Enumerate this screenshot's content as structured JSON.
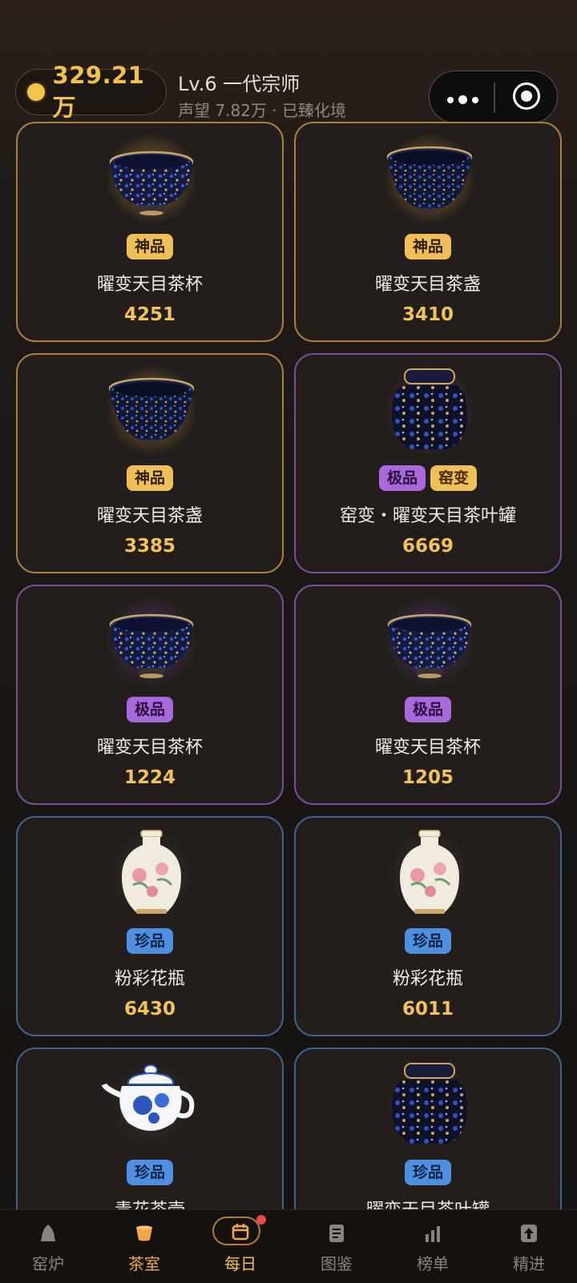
{
  "header": {
    "coins": "329.21万",
    "level_title": "Lv.6 一代宗师",
    "level_sub": "声望 7.82万 · 已臻化境"
  },
  "items": [
    {
      "name": "曜变天目茶杯",
      "value": "4251",
      "badges": [
        "神品"
      ],
      "rarity": "shen",
      "art": "cup"
    },
    {
      "name": "曜变天目茶盏",
      "value": "3410",
      "badges": [
        "神品"
      ],
      "rarity": "shen",
      "art": "bowl"
    },
    {
      "name": "曜变天目茶盏",
      "value": "3385",
      "badges": [
        "神品"
      ],
      "rarity": "shen",
      "art": "bowl"
    },
    {
      "name": "窑变・曜变天目茶叶罐",
      "value": "6669",
      "badges": [
        "极品",
        "窑变"
      ],
      "rarity": "ji",
      "art": "jar"
    },
    {
      "name": "曜变天目茶杯",
      "value": "1224",
      "badges": [
        "极品"
      ],
      "rarity": "ji",
      "art": "cup"
    },
    {
      "name": "曜变天目茶杯",
      "value": "1205",
      "badges": [
        "极品"
      ],
      "rarity": "ji",
      "art": "cup"
    },
    {
      "name": "粉彩花瓶",
      "value": "6430",
      "badges": [
        "珍品"
      ],
      "rarity": "zhen",
      "art": "vase"
    },
    {
      "name": "粉彩花瓶",
      "value": "6011",
      "badges": [
        "珍品"
      ],
      "rarity": "zhen",
      "art": "vase"
    },
    {
      "name": "青花茶壶",
      "value": "",
      "badges": [
        "珍品"
      ],
      "rarity": "zhen",
      "art": "teapot"
    },
    {
      "name": "曜变天目茶叶罐",
      "value": "",
      "badges": [
        "珍品"
      ],
      "rarity": "zhen",
      "art": "jar"
    }
  ],
  "nav": [
    {
      "label": "窑炉",
      "icon": "kiln-icon"
    },
    {
      "label": "茶室",
      "icon": "teacup-icon"
    },
    {
      "label": "每日",
      "icon": "calendar-icon"
    },
    {
      "label": "图鉴",
      "icon": "catalog-icon"
    },
    {
      "label": "榜单",
      "icon": "ranking-icon"
    },
    {
      "label": "精进",
      "icon": "upgrade-icon"
    }
  ],
  "colors": {
    "accent_gold": "#f3c24c",
    "rarity_shen": "#a8803f",
    "rarity_ji": "#7a4e9d",
    "rarity_zhen": "#3d6294",
    "nav_active": "#f0a64a",
    "notification": "#e84a4a"
  }
}
